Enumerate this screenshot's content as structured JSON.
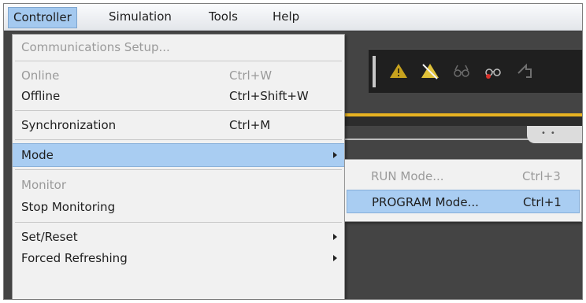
{
  "menubar": {
    "items": [
      {
        "label": "Controller"
      },
      {
        "label": "Simulation"
      },
      {
        "label": "Tools"
      },
      {
        "label": "Help"
      }
    ]
  },
  "controller_menu": {
    "communications_setup": {
      "label": "Communications Setup..."
    },
    "online": {
      "label": "Online",
      "shortcut": "Ctrl+W"
    },
    "offline": {
      "label": "Offline",
      "shortcut": "Ctrl+Shift+W"
    },
    "synchronization": {
      "label": "Synchronization",
      "shortcut": "Ctrl+M"
    },
    "mode": {
      "label": "Mode"
    },
    "monitor": {
      "label": "Monitor"
    },
    "stop_monitoring": {
      "label": "Stop Monitoring"
    },
    "set_reset": {
      "label": "Set/Reset"
    },
    "forced_refreshing": {
      "label": "Forced Refreshing"
    }
  },
  "mode_submenu": {
    "run_mode": {
      "label": "RUN Mode...",
      "shortcut": "Ctrl+3"
    },
    "program_mode": {
      "label": "PROGRAM Mode...",
      "shortcut": "Ctrl+1"
    }
  },
  "toolbar_icons": [
    "warning-triangle-icon",
    "warning-slash-icon",
    "glasses-icon",
    "glasses-alert-icon",
    "arrow-icon"
  ],
  "colors": {
    "highlight": "#a9cdf2",
    "accent_stripe": "#e8b321",
    "dark_background": "#444444"
  }
}
